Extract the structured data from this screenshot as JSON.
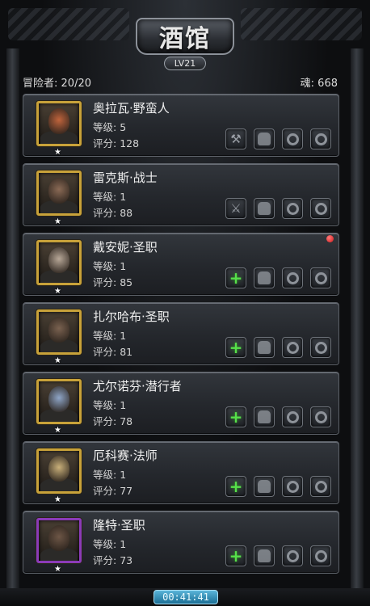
{
  "header": {
    "title": "酒馆",
    "level": "LV21"
  },
  "info": {
    "adventurers_label": "冒险者:",
    "adventurers_value": "20/20",
    "soul_label": "魂:",
    "soul_value": "668"
  },
  "heroes": [
    {
      "name": "奥拉瓦·野蛮人",
      "level_label": "等级:",
      "level": "5",
      "score_label": "评分:",
      "score": "128",
      "frame": "gold",
      "face_color": "#c0643c",
      "slots": [
        "axe-icon",
        "armor-icon",
        "ring-icon",
        "ring-icon"
      ],
      "badge": false
    },
    {
      "name": "雷克斯·战士",
      "level_label": "等级:",
      "level": "1",
      "score_label": "评分:",
      "score": "88",
      "frame": "gold",
      "face_color": "#8a6a55",
      "slots": [
        "sword-icon",
        "armor-icon",
        "ring-icon",
        "ring-icon"
      ],
      "badge": false
    },
    {
      "name": "戴安妮·圣职",
      "level_label": "等级:",
      "level": "1",
      "score_label": "评分:",
      "score": "85",
      "frame": "gold",
      "face_color": "#b8a898",
      "slots": [
        "plus-icon",
        "armor-icon",
        "ring-icon",
        "ring-icon"
      ],
      "badge": true
    },
    {
      "name": "扎尔哈布·圣职",
      "level_label": "等级:",
      "level": "1",
      "score_label": "评分:",
      "score": "81",
      "frame": "gold",
      "face_color": "#7a6250",
      "slots": [
        "plus-icon",
        "armor-icon",
        "ring-icon",
        "ring-icon"
      ],
      "badge": false
    },
    {
      "name": "尤尔诺芬·潜行者",
      "level_label": "等级:",
      "level": "1",
      "score_label": "评分:",
      "score": "78",
      "frame": "gold",
      "face_color": "#8fa6c8",
      "slots": [
        "plus-icon",
        "armor-icon",
        "ring-icon",
        "ring-icon"
      ],
      "badge": false
    },
    {
      "name": "厄科赛·法师",
      "level_label": "等级:",
      "level": "1",
      "score_label": "评分:",
      "score": "77",
      "frame": "gold",
      "face_color": "#c9b07a",
      "slots": [
        "plus-icon",
        "armor-icon",
        "ring-icon",
        "ring-icon"
      ],
      "badge": false
    },
    {
      "name": "隆特·圣职",
      "level_label": "等级:",
      "level": "1",
      "score_label": "评分:",
      "score": "73",
      "frame": "purple",
      "face_color": "#6d5646",
      "slots": [
        "plus-icon",
        "armor-icon",
        "ring-icon",
        "ring-icon"
      ],
      "badge": false
    }
  ],
  "timer": "00:41:41",
  "colors": {
    "gold_frame": "#c8a23a",
    "purple_frame": "#8b3bb8",
    "plus_green": "#57e04a",
    "timer_blue": "#3a9cc6"
  }
}
